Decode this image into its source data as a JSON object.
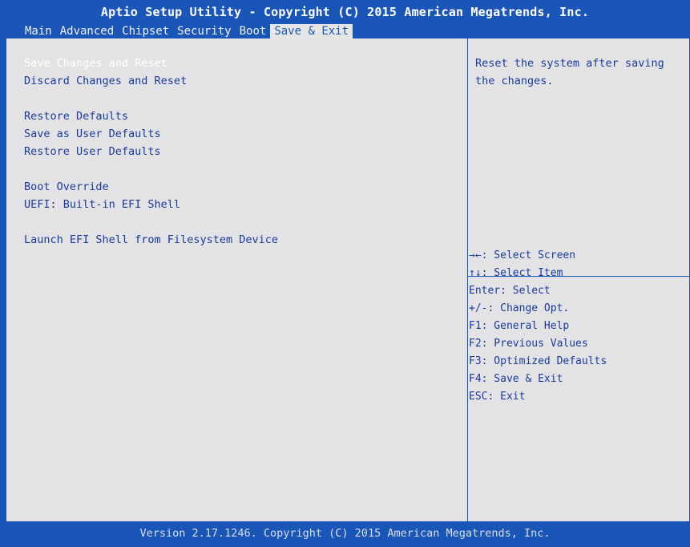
{
  "header": {
    "title": "Aptio Setup Utility - Copyright (C) 2015 American Megatrends, Inc."
  },
  "tabs": [
    {
      "label": "Main"
    },
    {
      "label": "Advanced"
    },
    {
      "label": "Chipset"
    },
    {
      "label": "Security"
    },
    {
      "label": "Boot"
    },
    {
      "label": "Save & Exit",
      "active": true
    }
  ],
  "menu": {
    "items": [
      {
        "label": "Save Changes and Reset",
        "selected": true
      },
      {
        "label": "Discard Changes and Reset"
      },
      {
        "label": "Restore Defaults"
      },
      {
        "label": "Save as User Defaults"
      },
      {
        "label": "Restore User Defaults"
      },
      {
        "label": "Boot Override"
      },
      {
        "label": "UEFI: Built-in EFI Shell"
      },
      {
        "label": "Launch EFI Shell from Filesystem Device"
      }
    ]
  },
  "help": {
    "text": "Reset the system after saving the changes."
  },
  "keys": [
    {
      "text": "→←: Select Screen"
    },
    {
      "text": "↑↓: Select Item"
    },
    {
      "text": "Enter: Select"
    },
    {
      "text": "+/-: Change Opt."
    },
    {
      "text": "F1: General Help"
    },
    {
      "text": "F2: Previous Values"
    },
    {
      "text": "F3: Optimized Defaults"
    },
    {
      "text": "F4: Save & Exit"
    },
    {
      "text": "ESC: Exit"
    }
  ],
  "footer": {
    "text": "Version 2.17.1246. Copyright (C) 2015 American Megatrends, Inc."
  },
  "colors": {
    "frame": "#1a56b8",
    "panel": "#e3e3e6",
    "text": "#1a3a9a",
    "selected_text": "#ffffff"
  }
}
